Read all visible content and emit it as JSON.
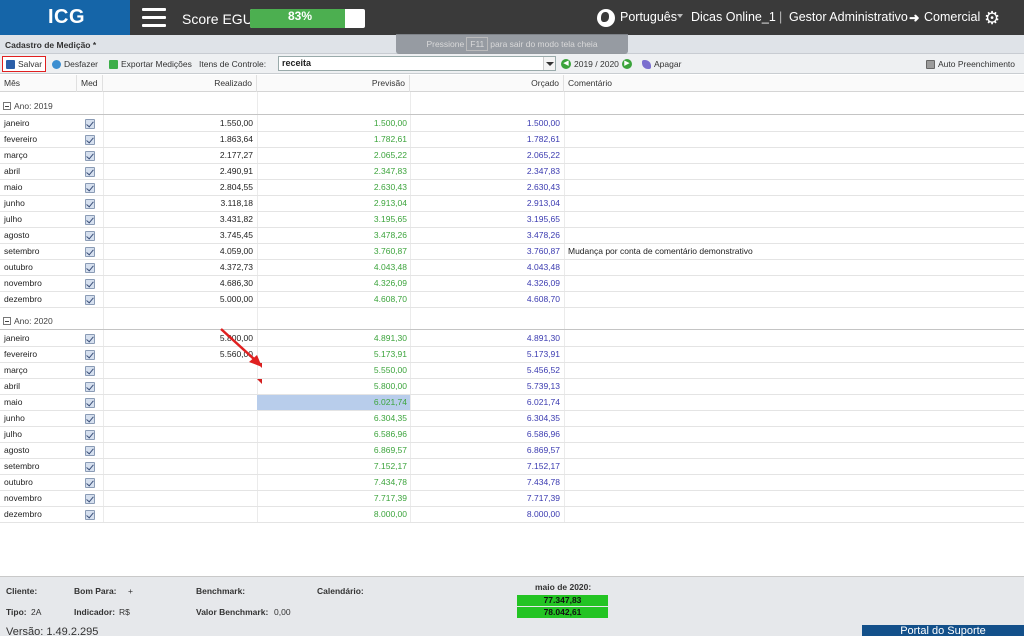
{
  "header": {
    "logo": "ICG",
    "score_label": "Score EGU:",
    "score_value": "83%",
    "score_fraction": 0.83,
    "language": "Português",
    "user": "Dicas Online_1",
    "role_from": "Gestor Administrativo",
    "role_to": "Comercial",
    "fullscreen_hint": {
      "pre": "Pressione",
      "key": "F11",
      "post": "para sair do modo tela cheia"
    }
  },
  "panel": {
    "title": "Cadastro de Medição *"
  },
  "toolbar": {
    "save": "Salvar",
    "undo": "Desfazer",
    "export": "Exportar Medições",
    "items_label": "Itens de Controle:",
    "items_value": "receita",
    "period": "2019 / 2020",
    "delete": "Apagar",
    "auto_fill": "Auto Preenchimento"
  },
  "grid": {
    "columns": {
      "mes": "Mês",
      "med": "Med",
      "realizado": "Realizado",
      "previsao": "Previsão",
      "orcado": "Orçado",
      "comentario": "Comentário"
    },
    "groups": [
      {
        "label": "Ano: 2019",
        "rows": [
          {
            "mes": "janeiro",
            "realizado": "1.550,00",
            "previsao": "1.500,00",
            "orcado": "1.500,00",
            "comentario": ""
          },
          {
            "mes": "fevereiro",
            "realizado": "1.863,64",
            "previsao": "1.782,61",
            "orcado": "1.782,61",
            "comentario": ""
          },
          {
            "mes": "março",
            "realizado": "2.177,27",
            "previsao": "2.065,22",
            "orcado": "2.065,22",
            "comentario": ""
          },
          {
            "mes": "abril",
            "realizado": "2.490,91",
            "previsao": "2.347,83",
            "orcado": "2.347,83",
            "comentario": ""
          },
          {
            "mes": "maio",
            "realizado": "2.804,55",
            "previsao": "2.630,43",
            "orcado": "2.630,43",
            "comentario": ""
          },
          {
            "mes": "junho",
            "realizado": "3.118,18",
            "previsao": "2.913,04",
            "orcado": "2.913,04",
            "comentario": ""
          },
          {
            "mes": "julho",
            "realizado": "3.431,82",
            "previsao": "3.195,65",
            "orcado": "3.195,65",
            "comentario": ""
          },
          {
            "mes": "agosto",
            "realizado": "3.745,45",
            "previsao": "3.478,26",
            "orcado": "3.478,26",
            "comentario": ""
          },
          {
            "mes": "setembro",
            "realizado": "4.059,00",
            "previsao": "3.760,87",
            "orcado": "3.760,87",
            "comentario": "Mudança por conta de comentário demonstrativo"
          },
          {
            "mes": "outubro",
            "realizado": "4.372,73",
            "previsao": "4.043,48",
            "orcado": "4.043,48",
            "comentario": ""
          },
          {
            "mes": "novembro",
            "realizado": "4.686,30",
            "previsao": "4.326,09",
            "orcado": "4.326,09",
            "comentario": ""
          },
          {
            "mes": "dezembro",
            "realizado": "5.000,00",
            "previsao": "4.608,70",
            "orcado": "4.608,70",
            "comentario": ""
          }
        ]
      },
      {
        "label": "Ano: 2020",
        "rows": [
          {
            "mes": "janeiro",
            "realizado": "5.800,00",
            "previsao": "4.891,30",
            "orcado": "4.891,30",
            "comentario": ""
          },
          {
            "mes": "fevereiro",
            "realizado": "5.560,00",
            "previsao": "5.173,91",
            "orcado": "5.173,91",
            "comentario": ""
          },
          {
            "mes": "março",
            "realizado": "",
            "previsao": "5.550,00",
            "orcado": "5.456,52",
            "comentario": ""
          },
          {
            "mes": "abril",
            "realizado": "",
            "previsao": "5.800,00",
            "orcado": "5.739,13",
            "comentario": ""
          },
          {
            "mes": "maio",
            "realizado": "",
            "previsao": "6.021,74",
            "orcado": "6.021,74",
            "comentario": ""
          },
          {
            "mes": "junho",
            "realizado": "",
            "previsao": "6.304,35",
            "orcado": "6.304,35",
            "comentario": ""
          },
          {
            "mes": "julho",
            "realizado": "",
            "previsao": "6.586,96",
            "orcado": "6.586,96",
            "comentario": ""
          },
          {
            "mes": "agosto",
            "realizado": "",
            "previsao": "6.869,57",
            "orcado": "6.869,57",
            "comentario": ""
          },
          {
            "mes": "setembro",
            "realizado": "",
            "previsao": "7.152,17",
            "orcado": "7.152,17",
            "comentario": ""
          },
          {
            "mes": "outubro",
            "realizado": "",
            "previsao": "7.434,78",
            "orcado": "7.434,78",
            "comentario": ""
          },
          {
            "mes": "novembro",
            "realizado": "",
            "previsao": "7.717,39",
            "orcado": "7.717,39",
            "comentario": ""
          },
          {
            "mes": "dezembro",
            "realizado": "",
            "previsao": "8.000,00",
            "orcado": "8.000,00",
            "comentario": ""
          }
        ]
      }
    ]
  },
  "footer": {
    "cliente_label": "Cliente:",
    "bom_para_label": "Bom Para:",
    "bom_para_value": "+",
    "benchmark_label": "Benchmark:",
    "calendario_label": "Calendário:",
    "tipo_label": "Tipo:",
    "tipo_value": "2A",
    "indicador_label": "Indicador:",
    "indicador_value": "R$",
    "valor_benchmark_label": "Valor Benchmark:",
    "valor_benchmark_value": "0,00",
    "period_title": "maio de 2020:",
    "total_1": "77.347,83",
    "total_2": "78.042,61",
    "version": "Versão: 1.49.2.295",
    "portal": "Portal do Suporte"
  },
  "colors": {
    "header_bg": "#3a3a3a",
    "logo_bg": "#1565a8",
    "score_green": "#4caf50",
    "previsao_green": "#3ca43c",
    "orcado_blue": "#3a3ab0",
    "selected_cell": "#b8cdeb",
    "annotation_red": "#e02020"
  },
  "icons": [
    "hamburger-icon",
    "globe-icon",
    "arrow-right-icon",
    "gear-icon",
    "save-icon",
    "undo-icon",
    "export-icon",
    "prev-period-icon",
    "next-period-icon",
    "eraser-icon",
    "auto-fill-icon"
  ]
}
